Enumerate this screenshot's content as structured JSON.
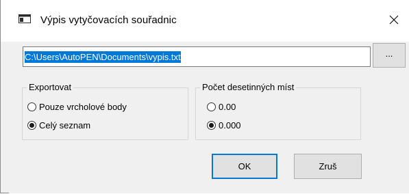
{
  "window": {
    "title": "Výpis vytyčovacích souřadnic",
    "close_glyph": "✕"
  },
  "file": {
    "path": "C:\\Users\\AutoPEN\\Documents\\vypis.txt",
    "browse_label": "..."
  },
  "export_group": {
    "legend": "Exportovat",
    "options": [
      {
        "label": "Pouze vrcholové body",
        "selected": false
      },
      {
        "label": "Celý seznam",
        "selected": true
      }
    ]
  },
  "decimals_group": {
    "legend": "Počet desetinných míst",
    "options": [
      {
        "label": "0.00",
        "selected": false
      },
      {
        "label": "0.000",
        "selected": true
      }
    ]
  },
  "buttons": {
    "ok_label": "OK",
    "cancel_label": "Zruš"
  },
  "colors": {
    "accent": "#0078d7",
    "dialog_bg": "#f0f0f0",
    "title_bg": "#ffffff"
  },
  "icons": {
    "app": "window-app-icon",
    "close": "close-icon"
  }
}
